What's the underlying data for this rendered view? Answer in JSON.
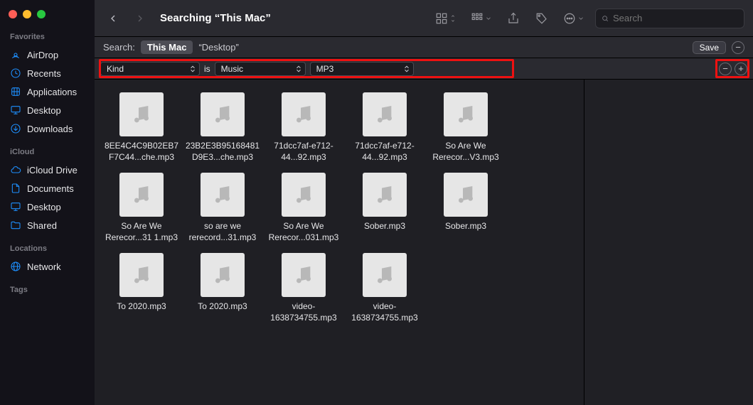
{
  "window": {
    "title": "Searching “This Mac”"
  },
  "sidebar": {
    "sections": [
      {
        "label": "Favorites",
        "items": [
          {
            "icon": "airdrop-icon",
            "label": "AirDrop"
          },
          {
            "icon": "clock-icon",
            "label": "Recents"
          },
          {
            "icon": "app-icon",
            "label": "Applications"
          },
          {
            "icon": "desktop-icon",
            "label": "Desktop"
          },
          {
            "icon": "download-icon",
            "label": "Downloads"
          }
        ]
      },
      {
        "label": "iCloud",
        "items": [
          {
            "icon": "cloud-icon",
            "label": "iCloud Drive"
          },
          {
            "icon": "doc-icon",
            "label": "Documents"
          },
          {
            "icon": "desktop-icon",
            "label": "Desktop"
          },
          {
            "icon": "folder-icon",
            "label": "Shared"
          }
        ]
      },
      {
        "label": "Locations",
        "items": [
          {
            "icon": "globe-icon",
            "label": "Network"
          }
        ]
      },
      {
        "label": "Tags",
        "items": []
      }
    ]
  },
  "toolbar": {
    "search_placeholder": "Search"
  },
  "scope": {
    "label": "Search:",
    "active": "This Mac",
    "alt": "“Desktop”",
    "save": "Save"
  },
  "criteria": {
    "attr": "Kind",
    "op": "is",
    "val1": "Music",
    "val2": "MP3"
  },
  "files": [
    {
      "name": "8EE4C4C9B02EB7F7C44...che.mp3"
    },
    {
      "name": "23B2E3B95168481D9E3...che.mp3"
    },
    {
      "name": "71dcc7af-e712-44...92.mp3"
    },
    {
      "name": "71dcc7af-e712-44...92.mp3"
    },
    {
      "name": "So Are We Rerecor...V3.mp3"
    },
    {
      "name": "So Are We Rerecor...31 1.mp3"
    },
    {
      "name": "so are we rerecord...31.mp3"
    },
    {
      "name": "So Are We Rerecor...031.mp3"
    },
    {
      "name": "Sober.mp3"
    },
    {
      "name": "Sober.mp3"
    },
    {
      "name": "To 2020.mp3"
    },
    {
      "name": "To 2020.mp3"
    },
    {
      "name": "video-1638734755.mp3"
    },
    {
      "name": "video-1638734755.mp3"
    }
  ]
}
